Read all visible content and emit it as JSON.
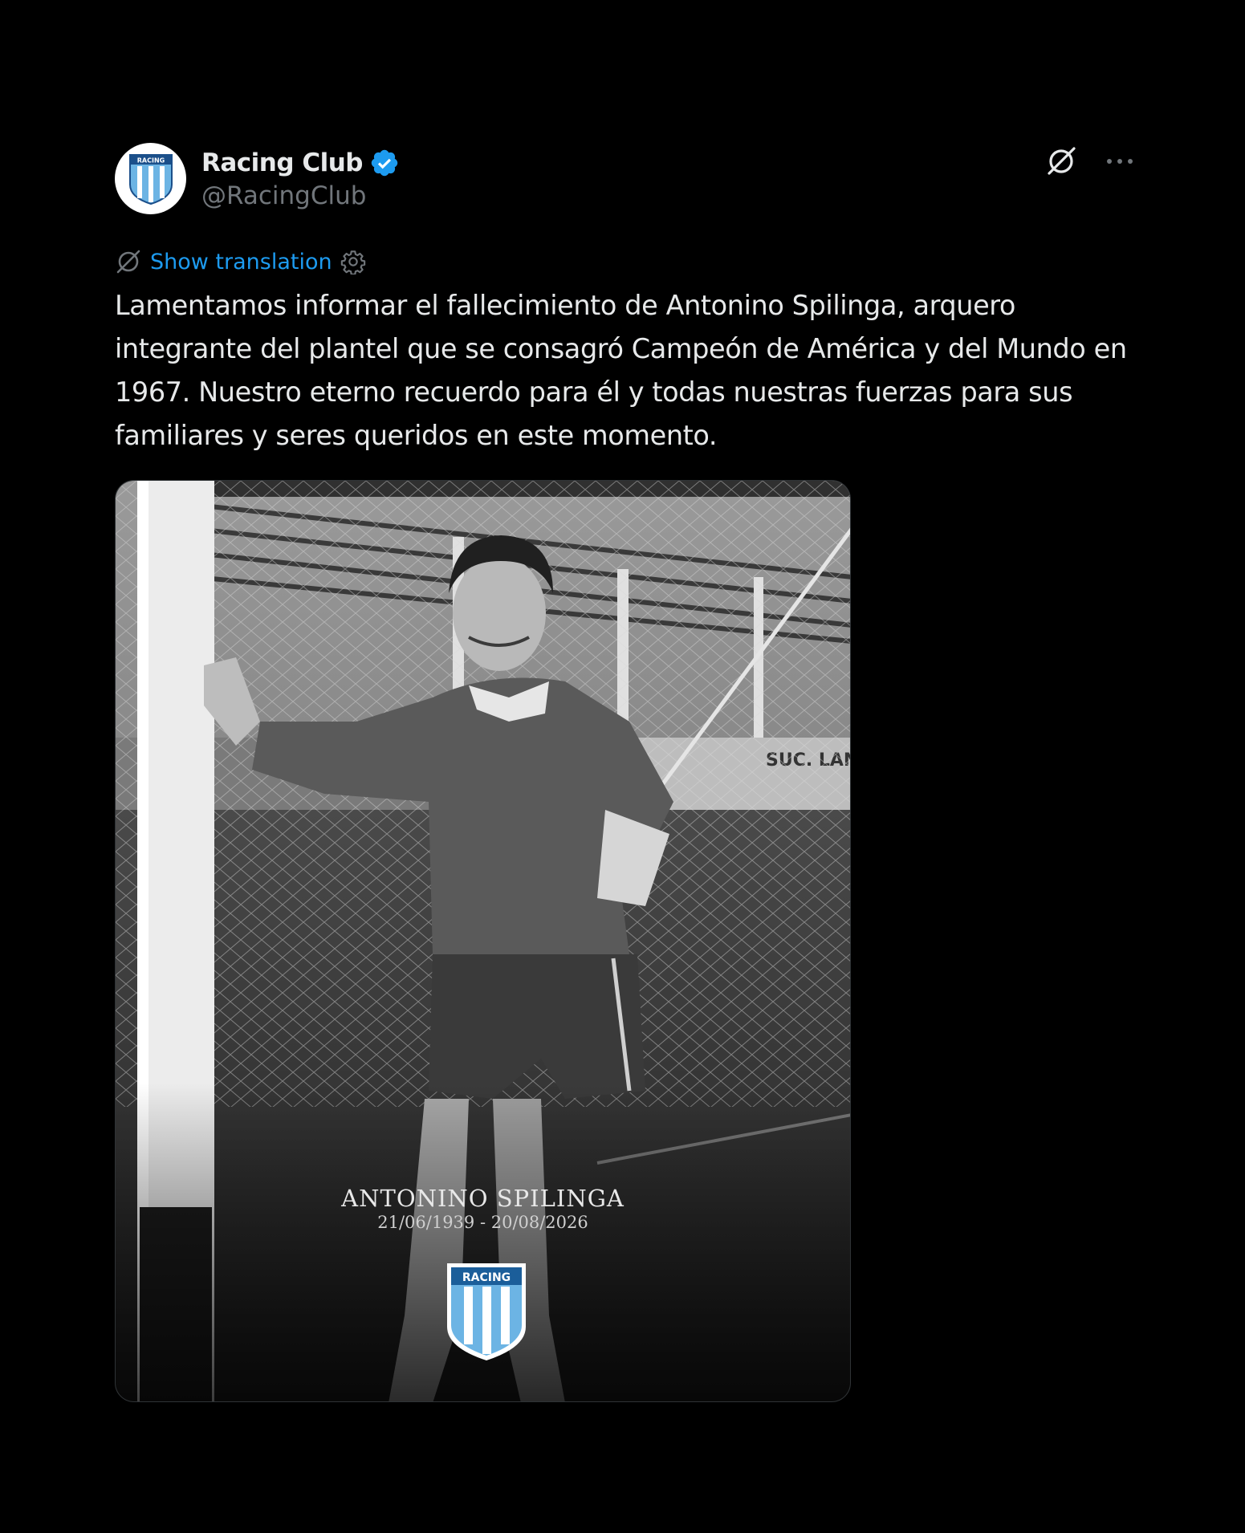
{
  "author": {
    "display_name": "Racing Club",
    "handle": "@RacingClub",
    "verified": true,
    "avatar_icon": "racing-club-crest-icon"
  },
  "header_actions": {
    "grok_icon": "grok-icon",
    "more_icon": "more-options-icon"
  },
  "translation": {
    "link_label": "Show translation",
    "settings_icon": "gear-icon"
  },
  "post": {
    "text": "Lamentamos informar el fallecimiento de Antonino Spilinga, arquero integrante del plantel que se consagró Campeón de América y del Mundo en 1967. Nuestro eterno recuerdo para él y todas nuestras fuerzas para sus familiares y seres queridos en este momento."
  },
  "media": {
    "memorial_name": "ANTONINO SPILINGA",
    "memorial_dates": "21/06/1939 - 20/08/2026",
    "crest_label": "RACING"
  },
  "colors": {
    "background": "#000000",
    "text": "#e7e9ea",
    "secondary_text": "#71767b",
    "link": "#1d9bf0",
    "verified": "#1d9bf0",
    "racing_sky_blue": "#6cb4e4"
  }
}
